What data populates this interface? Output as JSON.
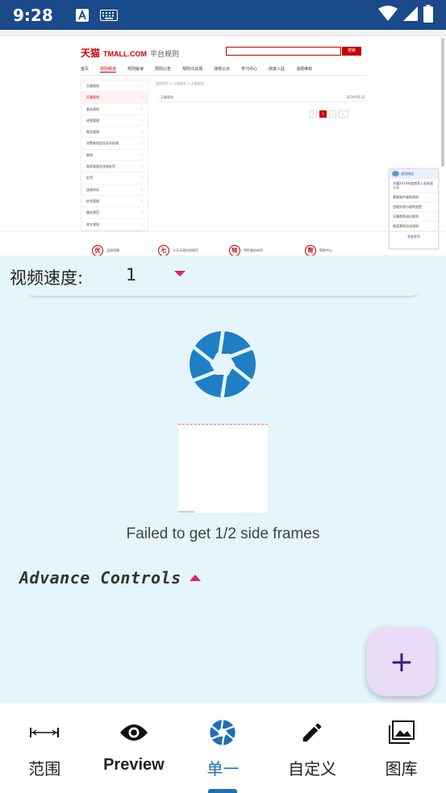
{
  "status_bar": {
    "time": "9:28",
    "icons": [
      "font-a-icon",
      "keyboard-icon",
      "wifi-icon",
      "signal-icon",
      "battery-icon"
    ]
  },
  "web_capture": {
    "brand": "天猫",
    "brand_en": "TMALL.COM",
    "subtitle": "平台规则",
    "search_button": "搜索",
    "nav": [
      "首页",
      "规则频道",
      "规则解读",
      "规则公告",
      "规则众议场",
      "违规公示",
      "学习中心",
      "商家入驻",
      "消费维权"
    ],
    "sidebar": [
      "天猫规则",
      "天猫规则",
      "基本规则",
      "经营管理",
      "商品管理",
      "消费者权益及投诉处理",
      "营销",
      "商家管理及违规处罚",
      "处罚",
      "违规申诉",
      "综合管理",
      "服务规范",
      "其它规则"
    ],
    "breadcrumb": "规则首页 > 天猫规则 > 天猫规则",
    "row_title": "天猫规则",
    "row_date": "2019-05-21",
    "pager_current": "1",
    "footer": [
      {
        "glyph": "优",
        "label": "品质保障"
      },
      {
        "glyph": "七",
        "label": "七天无理由退换货"
      },
      {
        "glyph": "特",
        "label": "特色服务体验"
      },
      {
        "glyph": "帮",
        "label": "帮助中心"
      }
    ],
    "support_title": "规则精选",
    "support_items": [
      "天猫2019年度商家入驻标准公告",
      "基础软件服务规则",
      "违规处理与规则变更",
      "天猫商家退出规则",
      "商家营销活动规则"
    ],
    "support_footer": "查看更多"
  },
  "speed": {
    "label": "视频速度:",
    "value": "1"
  },
  "status_message": "Failed to get 1/2 side frames",
  "advance_controls": "Advance Controls",
  "fab_label": "+",
  "bottom_nav": [
    {
      "label": "范围",
      "icon": "range-icon"
    },
    {
      "label": "Preview",
      "icon": "eye-icon"
    },
    {
      "label": "单一",
      "icon": "aperture-icon",
      "active": true
    },
    {
      "label": "自定义",
      "icon": "pencil-icon"
    },
    {
      "label": "图库",
      "icon": "gallery-icon"
    }
  ],
  "colors": {
    "status_bar": "#1a4a8a",
    "background": "#e4f5fb",
    "accent_pink": "#e91e63",
    "aperture_blue": "#1f7fc4",
    "active_nav": "#1f6fb2",
    "fab": "#e9dcf7"
  }
}
